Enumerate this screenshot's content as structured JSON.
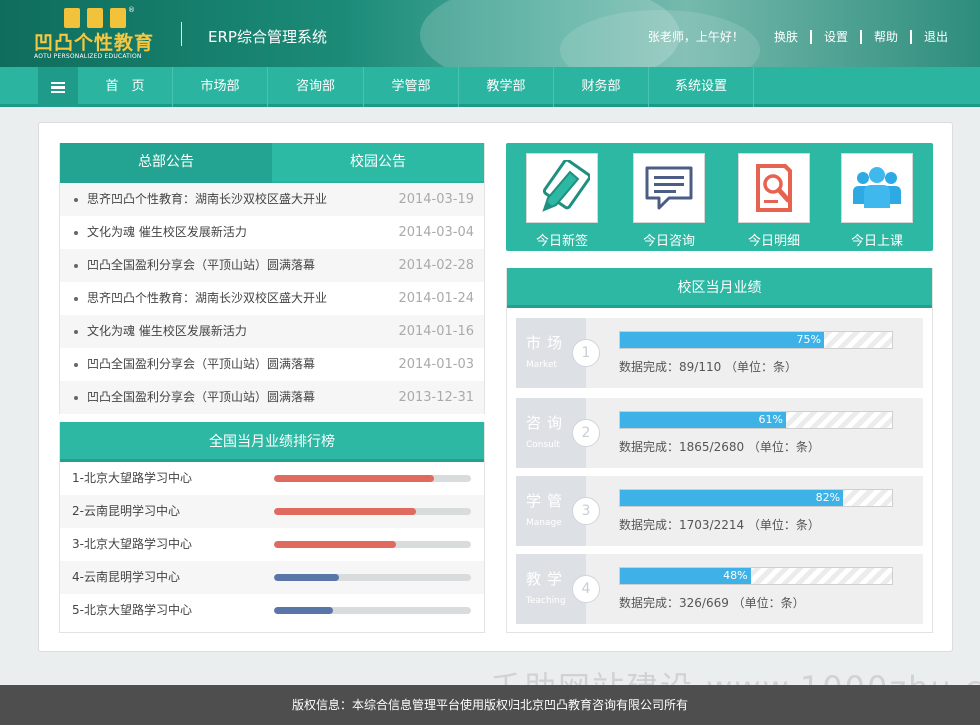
{
  "header": {
    "logo_text": "凹凸个性教育",
    "logo_sub": "AOTU PERSONALIZED EDUCATION",
    "logo_reg": "®",
    "system_title": "ERP综合管理系统",
    "greeting": "张老师，上午好！",
    "links": [
      "换肤",
      "设置",
      "帮助",
      "退出"
    ]
  },
  "nav": {
    "items": [
      "首　页",
      "市场部",
      "咨询部",
      "学管部",
      "教学部",
      "财务部",
      "系统设置"
    ]
  },
  "announcements": {
    "tabs": [
      "总部公告",
      "校园公告"
    ],
    "items": [
      {
        "title": "思齐凹凸个性教育：湖南长沙双校区盛大开业",
        "date": "2014-03-19"
      },
      {
        "title": "文化为魂 催生校区发展新活力",
        "date": "2014-03-04"
      },
      {
        "title": "凹凸全国盈利分享会（平顶山站）圆满落幕",
        "date": "2014-02-28"
      },
      {
        "title": "思齐凹凸个性教育：湖南长沙双校区盛大开业",
        "date": "2014-01-24"
      },
      {
        "title": "文化为魂 催生校区发展新活力",
        "date": "2014-01-16"
      },
      {
        "title": "凹凸全国盈利分享会（平顶山站）圆满落幕",
        "date": "2014-01-03"
      },
      {
        "title": "凹凸全国盈利分享会（平顶山站）圆满落幕",
        "date": "2013-12-31"
      }
    ]
  },
  "ranking": {
    "title": "全国当月业绩排行榜",
    "items": [
      {
        "name": "1-北京大望路学习中心",
        "fraction": 0.81,
        "color": "#e06a5e"
      },
      {
        "name": "2-云南昆明学习中心",
        "fraction": 0.72,
        "color": "#e06a5e"
      },
      {
        "name": "3-北京大望路学习中心",
        "fraction": 0.62,
        "color": "#e06a5e"
      },
      {
        "name": "4-云南昆明学习中心",
        "fraction": 0.33,
        "color": "#5a76a8"
      },
      {
        "name": "5-北京大望路学习中心",
        "fraction": 0.3,
        "color": "#5a76a8"
      }
    ]
  },
  "quick": {
    "items": [
      {
        "label": "今日新签",
        "icon": "pen-notebook-icon"
      },
      {
        "label": "今日咨询",
        "icon": "chat-bubble-icon"
      },
      {
        "label": "今日明细",
        "icon": "document-search-icon"
      },
      {
        "label": "今日上课",
        "icon": "group-users-icon"
      }
    ]
  },
  "performance": {
    "title": "校区当月业绩",
    "rows": [
      {
        "cn": "市场",
        "en": "Market",
        "num": "1",
        "percent": 75,
        "percent_label": "75%",
        "text": "数据完成：89/110 （单位：条）"
      },
      {
        "cn": "咨询",
        "en": "Consult",
        "num": "2",
        "percent": 61,
        "percent_label": "61%",
        "text": "数据完成：1865/2680 （单位：条）"
      },
      {
        "cn": "学管",
        "en": "Manage",
        "num": "3",
        "percent": 82,
        "percent_label": "82%",
        "text": "数据完成：1703/2214 （单位：条）"
      },
      {
        "cn": "教学",
        "en": "Teaching",
        "num": "4",
        "percent": 48,
        "percent_label": "48%",
        "text": "数据完成：326/669 （单位：条）"
      }
    ]
  },
  "footer": {
    "text": "版权信息：本综合信息管理平台使用版权归北京凹凸教育咨询有限公司所有",
    "watermark": "千助网站建设 www.1000zhu.com"
  },
  "colors": {
    "brand": "#2cb8a3",
    "brand_dark": "#23a391",
    "progress_blue": "#3eb2e6",
    "rank_red": "#e06a5e",
    "rank_blue": "#5a76a8"
  }
}
